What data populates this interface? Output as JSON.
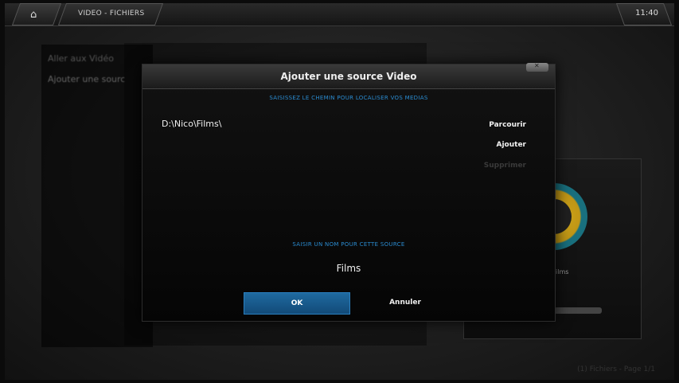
{
  "topbar": {
    "breadcrumb": "VIDEO - FICHIERS",
    "clock": "11:40"
  },
  "background": {
    "menu_items": [
      "Aller aux Vidéo",
      "Ajouter une sourc"
    ],
    "card_title": "Films",
    "status": "(1) Fichiers - Page 1/1"
  },
  "dialog": {
    "title": "Ajouter une source Video",
    "path_heading": "SAISISSEZ LE CHEMIN POUR LOCALISER VOS MEDIAS",
    "path_value": "D:\\Nico\\Films\\",
    "browse_label": "Parcourir",
    "add_label": "Ajouter",
    "remove_label": "Supprimer",
    "name_heading": "SAISIR UN NOM POUR CETTE SOURCE",
    "name_value": "Films",
    "ok_label": "OK",
    "cancel_label": "Annuler",
    "close_icon": "close-icon"
  },
  "colors": {
    "accent": "#2a8bd0",
    "ok_button": "#1a5f94"
  }
}
